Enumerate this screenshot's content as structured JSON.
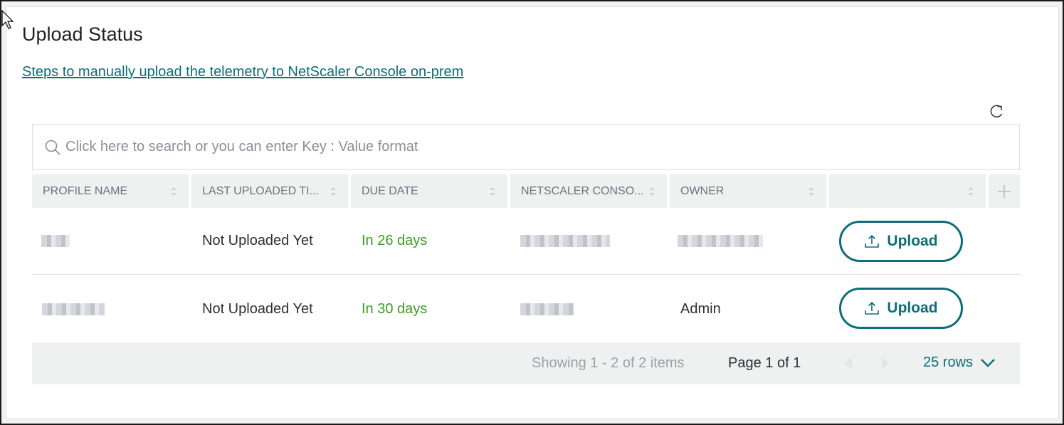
{
  "page": {
    "title": "Upload Status",
    "doc_link": "Steps to manually upload the telemetry to NetScaler Console on-prem"
  },
  "toolbar": {
    "refresh_icon": "refresh-icon"
  },
  "search": {
    "placeholder": "Click here to search or you can enter Key : Value format",
    "value": "",
    "icon": "search-icon"
  },
  "table": {
    "columns": [
      {
        "label": "PROFILE NAME",
        "sortable": true
      },
      {
        "label": "LAST UPLOADED TI...",
        "sortable": true
      },
      {
        "label": "DUE DATE",
        "sortable": true
      },
      {
        "label": "NETSCALER CONSO...",
        "sortable": true
      },
      {
        "label": "OWNER",
        "sortable": true
      },
      {
        "label": "",
        "sortable": true
      }
    ],
    "add_column_icon": "plus-icon",
    "rows": [
      {
        "profile_name": "[redacted]",
        "last_uploaded": "Not Uploaded Yet",
        "due_date": "In 26 days",
        "netscaler_console": "[redacted]",
        "owner": "[redacted]",
        "action_label": "Upload"
      },
      {
        "profile_name": "[redacted]",
        "last_uploaded": "Not Uploaded Yet",
        "due_date": "In 30 days",
        "netscaler_console": "[redacted]",
        "owner": "Admin",
        "action_label": "Upload"
      }
    ]
  },
  "pagination": {
    "showing": "Showing 1 - 2 of 2 items",
    "page": "Page 1 of 1",
    "rows_per_page": "25 rows"
  },
  "colors": {
    "accent": "#0b6e7a",
    "due_green": "#3b9b1e",
    "header_bg": "#eff1f1"
  }
}
